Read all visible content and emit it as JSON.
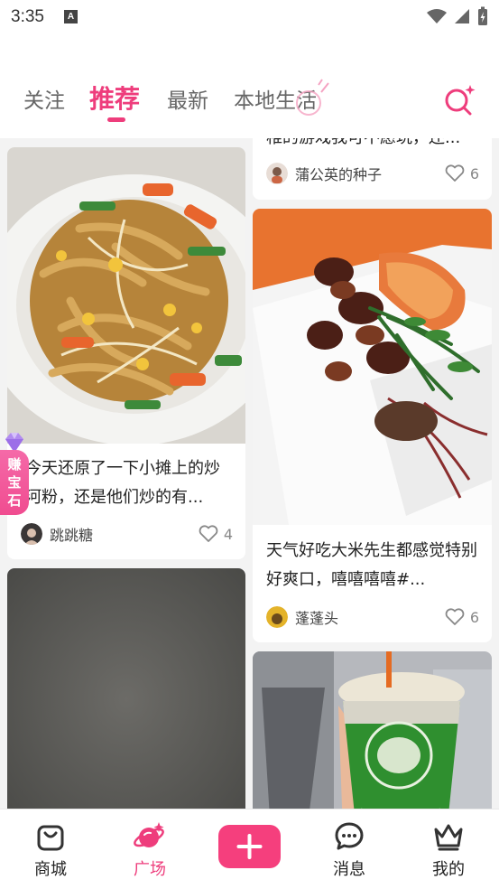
{
  "status_bar": {
    "time": "3:35",
    "notif": "A"
  },
  "header": {
    "tabs": [
      {
        "label": "关注"
      },
      {
        "label": "推荐"
      },
      {
        "label": "最新"
      },
      {
        "label": "本地生活"
      }
    ],
    "accent_color": "#ee3d7c"
  },
  "feed": {
    "left": [
      {
        "title": "今天还原了一下小摊上的炒河粉，还是他们炒的有...",
        "author": "跳跳糖",
        "likes": "4",
        "image": "fried-rice-noodles"
      },
      {
        "title": "",
        "author": "",
        "likes": "",
        "image": "dark-gray-photo"
      }
    ],
    "right": [
      {
        "title": "稚的游戏我可不愿玩，还...",
        "author": "蒲公英的种子",
        "likes": "6",
        "image": ""
      },
      {
        "title": "天气好吃大米先生都感觉特别好爽口，嘻嘻嘻嘻#...",
        "author": "蓬蓬头",
        "likes": "6",
        "image": "braised-meat-plate"
      },
      {
        "title": "",
        "author": "",
        "likes": "",
        "image": "green-tea-cup"
      }
    ]
  },
  "gem_badge": {
    "label": "赚宝石"
  },
  "bottom_nav": [
    {
      "label": "商城",
      "icon": "shopping-bag-icon"
    },
    {
      "label": "广场",
      "icon": "planet-icon"
    },
    {
      "label": "",
      "icon": "plus-icon"
    },
    {
      "label": "消息",
      "icon": "chat-bubble-icon"
    },
    {
      "label": "我的",
      "icon": "crown-icon"
    }
  ]
}
